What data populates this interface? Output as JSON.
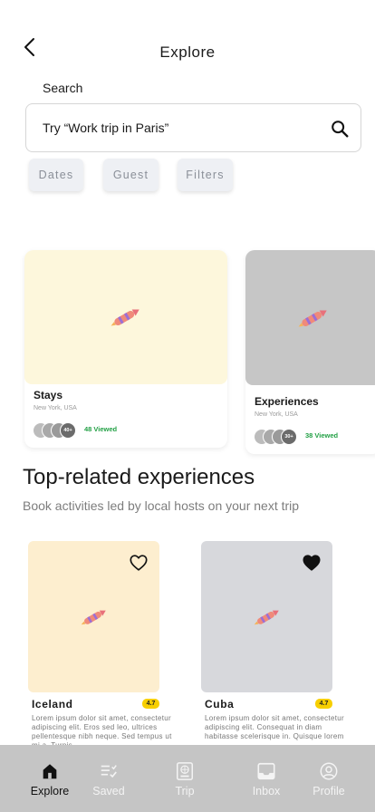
{
  "header": {
    "title": "Explore"
  },
  "search": {
    "label": "Search",
    "value": "Try “Work trip in Paris”"
  },
  "filters": [
    "Dates",
    "Guest",
    "Filters"
  ],
  "categories": [
    {
      "name": "Stays",
      "location": "New York, USA",
      "count_badge": "40+",
      "viewed": "48 Viewed",
      "bg": "#fdf7dc"
    },
    {
      "name": "Experiences",
      "location": "New York, USA",
      "count_badge": "30+",
      "viewed": "38 Viewed",
      "bg": "#c6c6c6"
    }
  ],
  "section": {
    "title": "Top-related experiences",
    "subtitle": "Book activities led by local hosts on your next trip"
  },
  "experiences": [
    {
      "name": "Iceland",
      "rating": "4.7",
      "favorite": false,
      "bg": "#fdeecf",
      "description": "Lorem ipsum dolor sit amet, consectetur adipiscing elit. Eros sed leo, ultrices pellentesque nibh neque. Sed tempus ut mi a. Turpis"
    },
    {
      "name": "Cuba",
      "rating": "4.7",
      "favorite": true,
      "bg": "#d7d8dc",
      "description": "Lorem ipsum dolor sit amet, consectetur adipiscing elit. Consequat in diam habitasse scelerisque in. Quisque lorem"
    }
  ],
  "tabs": [
    {
      "label": "Explore",
      "icon": "home-icon",
      "active": true
    },
    {
      "label": "Saved",
      "icon": "list-check-icon",
      "active": false
    },
    {
      "label": "Trip",
      "icon": "passport-icon",
      "active": false
    },
    {
      "label": "Inbox",
      "icon": "inbox-icon",
      "active": false
    },
    {
      "label": "Profile",
      "icon": "profile-icon",
      "active": false
    }
  ]
}
